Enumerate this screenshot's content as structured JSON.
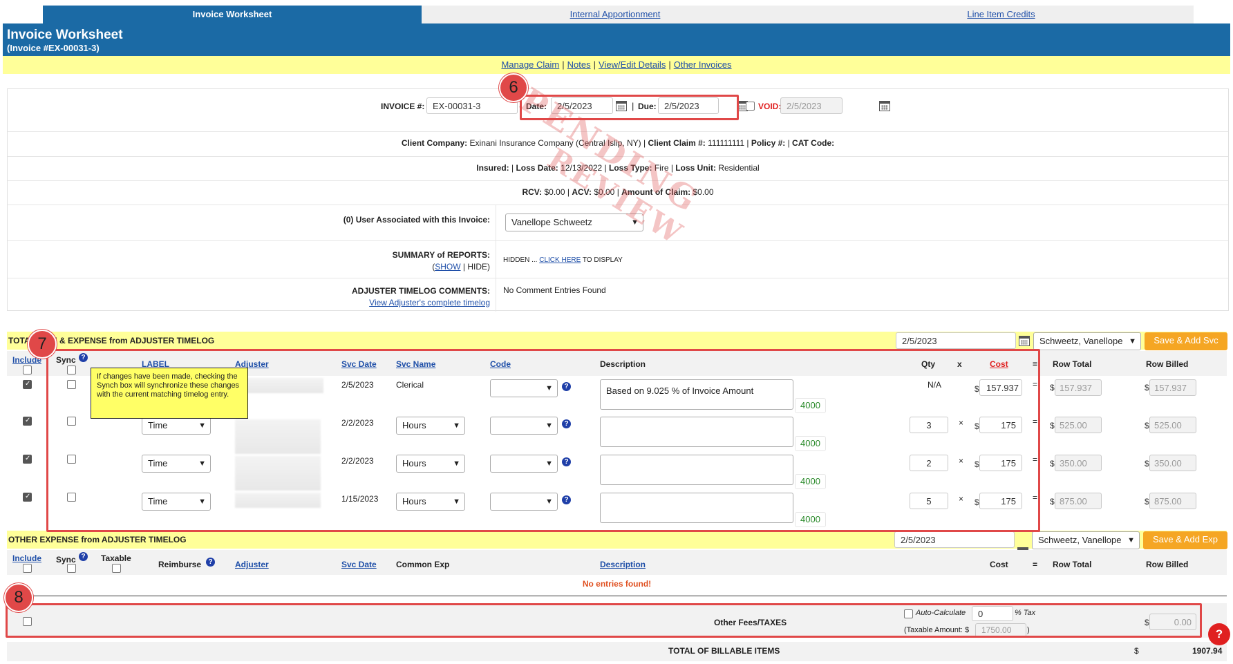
{
  "tabs": [
    {
      "label": "Invoice Worksheet",
      "active": true
    },
    {
      "label": "Internal Apportionment",
      "active": false
    },
    {
      "label": "Line Item Credits",
      "active": false
    }
  ],
  "header": {
    "title": "Invoice Worksheet",
    "subtitle": "(Invoice #EX-00031-3)"
  },
  "links": [
    "Manage Claim",
    "Notes",
    "View/Edit Details",
    "Other Invoices"
  ],
  "invoice": {
    "number_label": "INVOICE #:",
    "number": "EX-00031-3",
    "date_label": "Date:",
    "date": "2/5/2023",
    "due_label": "Due:",
    "due": "2/5/2023",
    "void_label": "VOID:",
    "void_date": "2/5/2023"
  },
  "client": {
    "company_label": "Client Company:",
    "company": "Exinani Insurance Company (Central Islip, NY)",
    "claim_label": "Client Claim #:",
    "claim": "111111111",
    "policy_label": "Policy #:",
    "cat_label": "CAT Code:"
  },
  "loss": {
    "insured_label": "Insured:",
    "loss_date_label": "Loss Date:",
    "loss_date": "12/13/2022",
    "loss_type_label": "Loss Type:",
    "loss_type": "Fire",
    "loss_unit_label": "Loss Unit:",
    "loss_unit": "Residential"
  },
  "amounts": {
    "rcv_label": "RCV:",
    "rcv": "$0.00",
    "acv_label": "ACV:",
    "acv": "$0.00",
    "claim_label": "Amount of Claim:",
    "claim": "$0.00"
  },
  "users": {
    "label": "(0) User Associated with this Invoice:",
    "selected": "Vanellope Schweetz"
  },
  "summary": {
    "label": "SUMMARY of REPORTS:",
    "show": "SHOW",
    "hide": "HIDE",
    "hidden_text": "HIDDEN ...",
    "click_here": "CLICK HERE",
    "to_display": "TO DISPLAY"
  },
  "timelog": {
    "label": "ADJUSTER TIMELOG COMMENTS:",
    "link": "View Adjuster's complete timelog",
    "value": "No Comment Entries Found"
  },
  "stamp": {
    "line1": "PENDING",
    "line2": "REVIEW"
  },
  "time_section": {
    "title": "TOTAL TIME & EXPENSE from ADJUSTER TIMELOG",
    "date": "2/5/2023",
    "adjuster": "Schweetz, Vanellope",
    "button": "Save & Add Svc",
    "headers": {
      "include": "Include",
      "sync": "Sync",
      "label": "LABEL",
      "adjuster": "Adjuster",
      "svc_date": "Svc Date",
      "svc_name": "Svc Name",
      "code": "Code",
      "description": "Description",
      "qty": "Qty",
      "x": "x",
      "cost": "Cost",
      "eq": "=",
      "row_total": "Row Total",
      "row_billed": "Row Billed"
    },
    "tooltip": "If changes have been made, checking the Synch box will synchronize these changes with the current matching timelog entry.",
    "rows": [
      {
        "label": "",
        "svc_date": "2/5/2023",
        "svc_name": "Clerical",
        "description": "Based on 9.025 % of Invoice Amount",
        "code_num": "4000",
        "qty": "N/A",
        "cost": "157.937",
        "row_total": "157.937",
        "row_billed": "157.937"
      },
      {
        "label": "Time",
        "svc_date": "2/2/2023",
        "svc_name": "Hours",
        "description": "",
        "code_num": "4000",
        "qty": "3",
        "cost": "175",
        "row_total": "525.00",
        "row_billed": "525.00"
      },
      {
        "label": "Time",
        "svc_date": "2/2/2023",
        "svc_name": "Hours",
        "description": "",
        "code_num": "4000",
        "qty": "2",
        "cost": "175",
        "row_total": "350.00",
        "row_billed": "350.00"
      },
      {
        "label": "Time",
        "svc_date": "1/15/2023",
        "svc_name": "Hours",
        "description": "",
        "code_num": "4000",
        "qty": "5",
        "cost": "175",
        "row_total": "875.00",
        "row_billed": "875.00"
      }
    ]
  },
  "other_section": {
    "title": "OTHER EXPENSE from ADJUSTER TIMELOG",
    "date": "2/5/2023",
    "adjuster": "Schweetz, Vanellope",
    "button": "Save & Add Exp",
    "headers": {
      "include": "Include",
      "sync": "Sync",
      "taxable": "Taxable",
      "reimburse": "Reimburse",
      "adjuster": "Adjuster",
      "svc_date": "Svc Date",
      "common_exp": "Common Exp",
      "description": "Description",
      "cost": "Cost",
      "eq": "=",
      "row_total": "Row Total",
      "row_billed": "Row Billed"
    },
    "empty": "No entries found!"
  },
  "fees": {
    "label": "Other Fees/TAXES",
    "auto_calc": "Auto-Calculate",
    "tax_value": "0",
    "tax_unit": "% Tax",
    "taxable_prefix": "(Taxable Amount: $",
    "taxable_amount": "1750.00",
    "taxable_suffix": ")",
    "total": "0.00"
  },
  "total": {
    "label": "TOTAL OF BILLABLE ITEMS",
    "currency": "$",
    "value": "1907.94"
  },
  "badges": [
    "6",
    "7",
    "8"
  ],
  "colors": {
    "header_blue": "#1b6aa5",
    "highlight_yellow": "#ffff99",
    "button_orange": "#f5a623",
    "annotation_red": "#e04848"
  }
}
